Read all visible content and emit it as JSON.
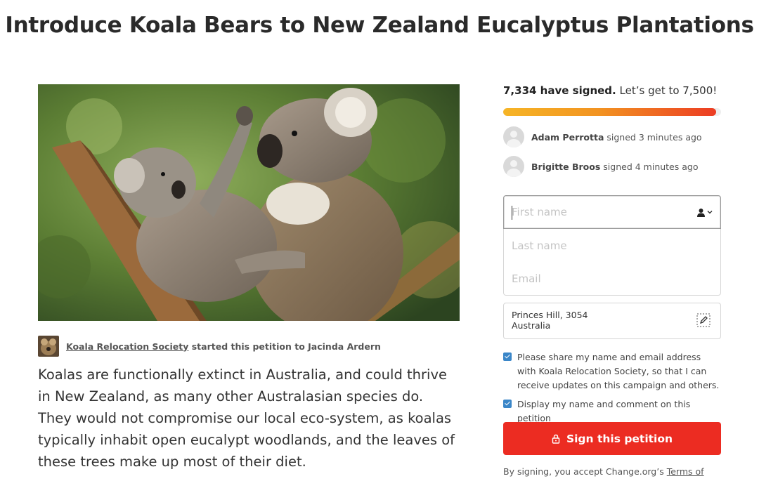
{
  "page": {
    "title": "Introduce Koala Bears to New Zealand Eucalyptus Plantations"
  },
  "hero": {
    "image_icon": "koala-photo"
  },
  "starter": {
    "organization": "Koala Relocation Society",
    "action_text": "started this petition to Jacinda Ardern"
  },
  "body": {
    "text": "Koalas are functionally extinct in Australia, and could thrive in New Zealand, as many other Australasian species do.  They would not compromise our local eco-system, as koalas typically inhabit open eucalypt woodlands, and the leaves of these trees make up most of their diet."
  },
  "signatures": {
    "count": "7,334 have signed.",
    "goal_text": "Let’s get to 7,500!",
    "signed": 7334,
    "goal": 7500,
    "progress_fraction": 0.978
  },
  "recent_signers": [
    {
      "name": "Adam Perrotta",
      "text": "signed 3 minutes ago"
    },
    {
      "name": "Brigitte Broos",
      "text": "signed 4 minutes ago"
    }
  ],
  "form": {
    "first_name_placeholder": "First name",
    "last_name_placeholder": "Last name",
    "email_placeholder": "Email",
    "location_line1": "Princes Hill, 3054",
    "location_line2": "Australia",
    "share_checkbox_label": "Please share my name and email address with Koala Relocation Society, so that I can receive updates on this campaign and others.",
    "display_checkbox_label": "Display my name and comment on this petition",
    "share_checked": true,
    "display_checked": true,
    "sign_button_label": "Sign this petition",
    "terms_prefix": "By signing, you accept Change.org’s",
    "terms_link": "Terms of"
  },
  "colors": {
    "accent": "#ec2c22",
    "checkbox": "#3a86c8",
    "progress_start": "#f6b526",
    "progress_end": "#ec3c23"
  }
}
